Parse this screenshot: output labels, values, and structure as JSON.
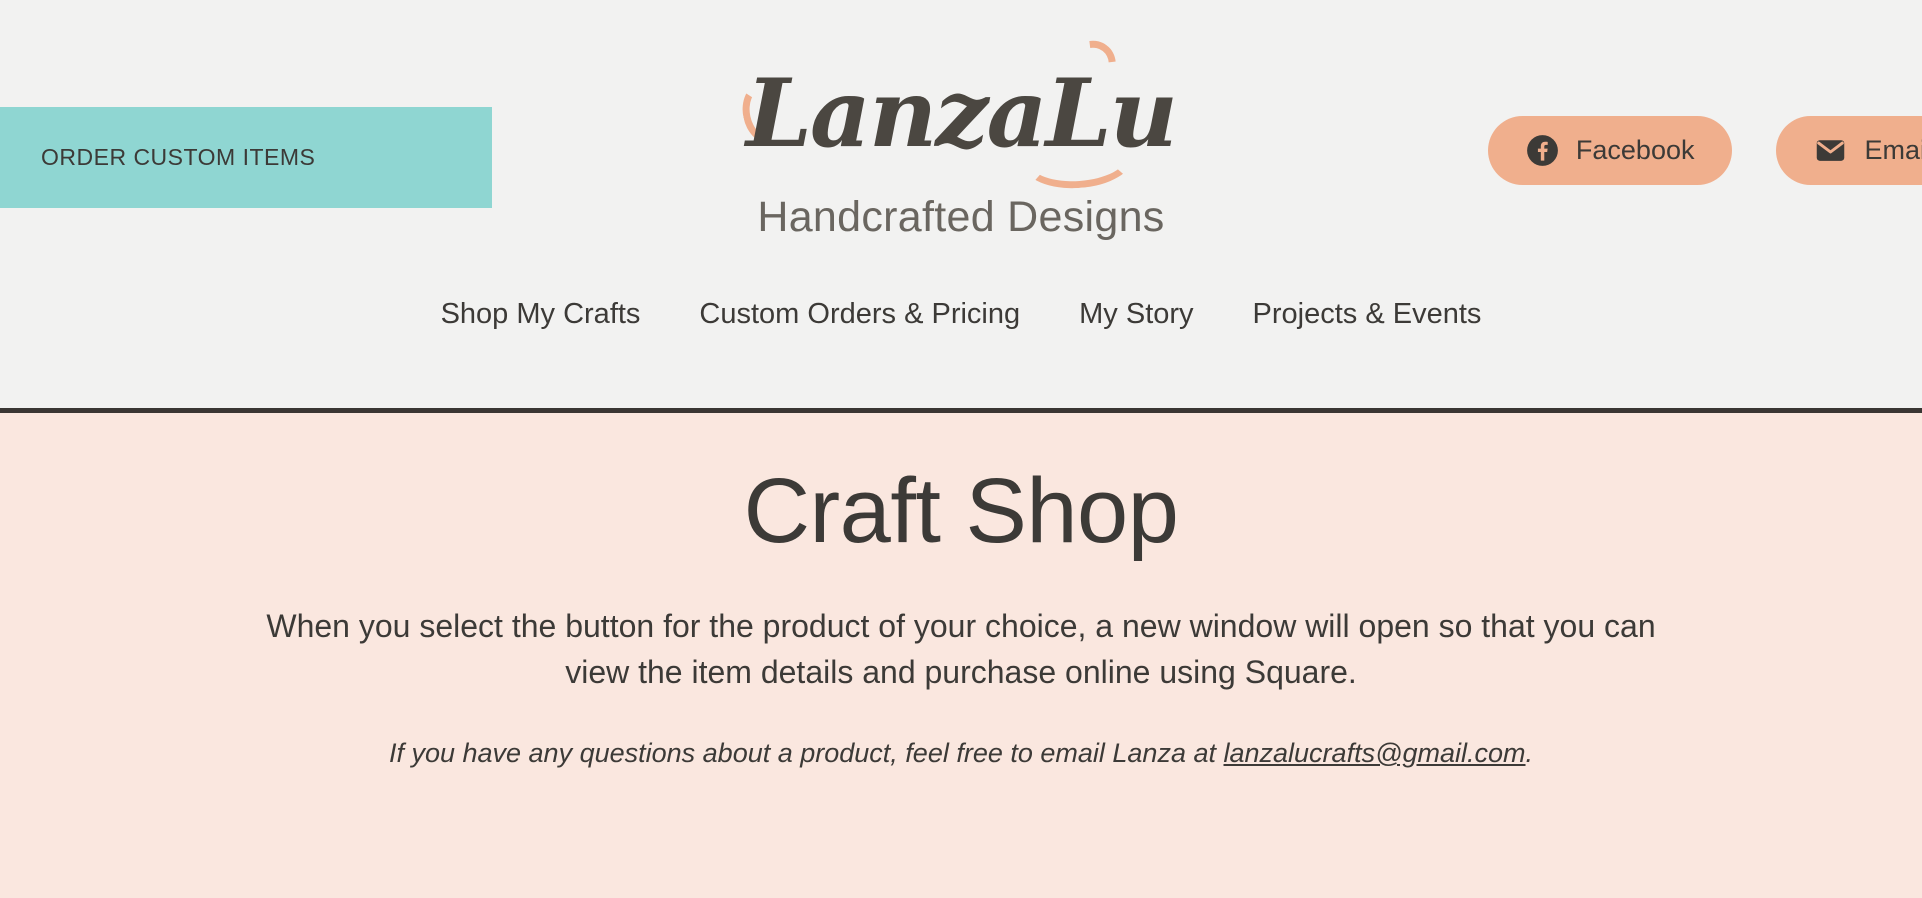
{
  "header": {
    "order_button": {
      "label": "ORDER CUSTOM ITEMS"
    },
    "logo": {
      "script_text": "LanzaLu",
      "subtitle": "Handcrafted Designs",
      "accent_color": "#f0af8d",
      "text_color": "#4b4741"
    },
    "social": [
      {
        "name": "facebook",
        "label": "Facebook",
        "icon": "facebook-icon"
      },
      {
        "name": "email",
        "label": "Email",
        "icon": "envelope-icon"
      }
    ],
    "nav": [
      {
        "label": "Shop My Crafts"
      },
      {
        "label": "Custom Orders & Pricing"
      },
      {
        "label": "My Story"
      },
      {
        "label": "Projects & Events"
      }
    ],
    "background_color": "#f2f2f1",
    "rule_color": "#3a3633",
    "teal_color": "#8fd6d2"
  },
  "hero": {
    "title": "Craft Shop",
    "paragraph": "When you select the button for the product of your choice, a new window will open so that you can view the item details and purchase online using Square.",
    "note_prefix": "If you have any questions about a product, feel free to email Lanza at ",
    "note_email": "lanzalucrafts@gmail.com",
    "note_suffix": ".",
    "background_color": "#fae7df",
    "text_color": "#3c3a37"
  }
}
